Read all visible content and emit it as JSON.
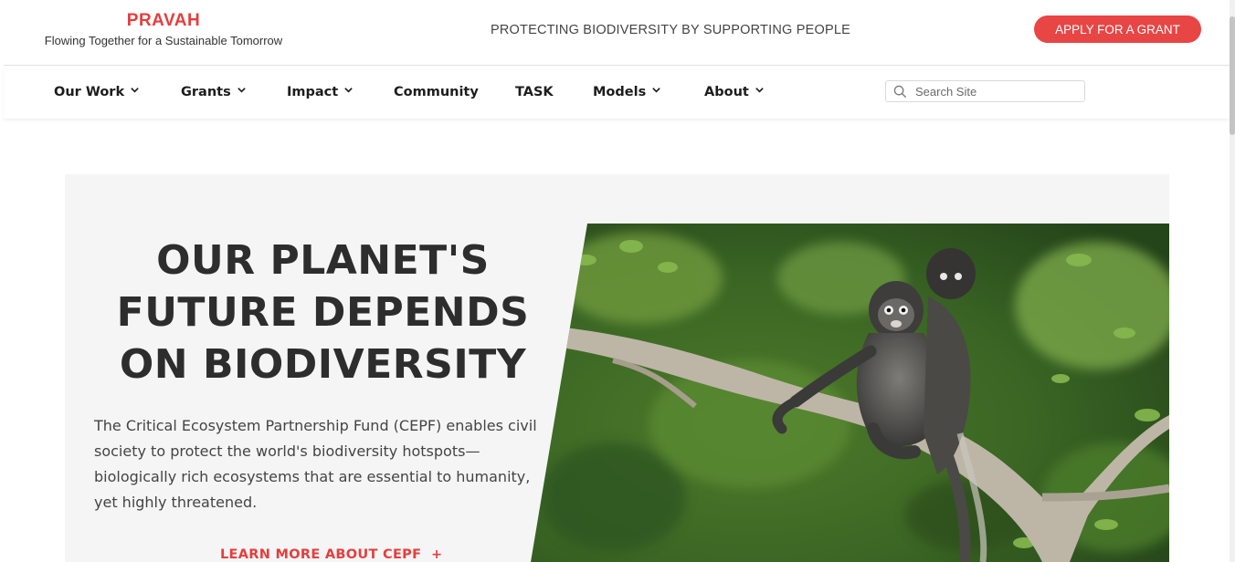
{
  "header": {
    "brand_name": "PRAVAH",
    "brand_tagline": "Flowing Together for a Sustainable Tomorrow",
    "mission": "PROTECTING BIODIVERSITY BY SUPPORTING PEOPLE",
    "cta_label": "APPLY FOR A GRANT",
    "accent_color": "#e84545"
  },
  "nav": {
    "items": [
      {
        "label": "Our Work",
        "has_dropdown": true
      },
      {
        "label": "Grants",
        "has_dropdown": true
      },
      {
        "label": "Impact",
        "has_dropdown": true
      },
      {
        "label": "Community",
        "has_dropdown": false
      },
      {
        "label": "TASK",
        "has_dropdown": false
      },
      {
        "label": "Models",
        "has_dropdown": true
      },
      {
        "label": "About",
        "has_dropdown": true
      }
    ],
    "search_placeholder": "Search Site",
    "search_icon": "search-icon",
    "dropdown_icon": "chevron-down-icon"
  },
  "hero": {
    "title": "OUR PLANET'S FUTURE DEPENDS ON BIODIVERSITY",
    "body": "The Critical Ecosystem Partnership Fund (CEPF) enables civil society to protect the world's biodiversity hotspots—biologically rich ecosystems that are essential to humanity, yet highly threatened.",
    "link_label": "LEARN MORE ABOUT CEPF",
    "link_icon": "plus-icon"
  }
}
